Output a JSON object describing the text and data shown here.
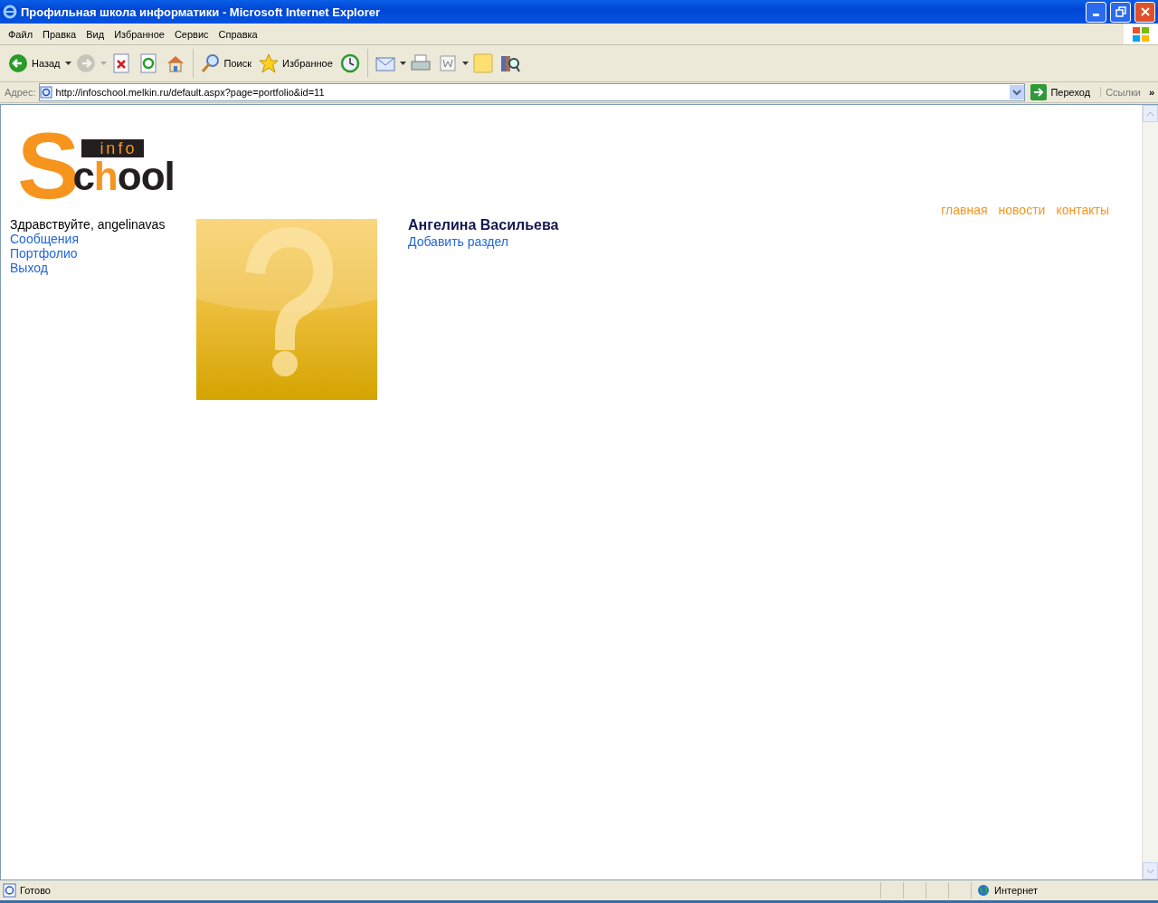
{
  "window": {
    "title": "Профильная школа информатики - Microsoft Internet Explorer"
  },
  "menu": [
    "Файл",
    "Правка",
    "Вид",
    "Избранное",
    "Сервис",
    "Справка"
  ],
  "toolbar": [
    {
      "kind": "back",
      "label": "Назад",
      "disabled": false,
      "has_menu": true
    },
    {
      "kind": "forward",
      "disabled": true,
      "has_menu": true
    },
    {
      "kind": "stop",
      "disabled": false,
      "has_menu": false
    },
    {
      "kind": "refresh",
      "disabled": false,
      "has_menu": false
    },
    {
      "kind": "home",
      "disabled": false,
      "has_menu": false
    },
    {
      "kind": "search",
      "label": "Поиск",
      "disabled": false,
      "has_menu": false
    },
    {
      "kind": "favorites",
      "label": "Избранное",
      "disabled": false,
      "has_menu": false
    },
    {
      "kind": "history",
      "disabled": false,
      "has_menu": false
    },
    {
      "kind": "mail",
      "disabled": false,
      "has_menu": true
    },
    {
      "kind": "print",
      "disabled": false,
      "has_menu": false
    },
    {
      "kind": "edit",
      "disabled": false,
      "has_menu": true
    },
    {
      "kind": "note",
      "disabled": false,
      "has_menu": false
    },
    {
      "kind": "research",
      "disabled": false,
      "has_menu": false
    }
  ],
  "address": {
    "label": "Адрес:",
    "value": "http://infoschool.melkin.ru/default.aspx?page=portfolio&id=11",
    "go": "Переход",
    "links": "Ссылки",
    "more": "»"
  },
  "page": {
    "logo": {
      "top": "info",
      "initial": "S",
      "rest": "chool"
    },
    "nav": [
      "главная",
      "новости",
      "контакты"
    ],
    "greeting": "Здравствуйте, angelinavas",
    "sidebar": [
      "Сообщения",
      "Портфолио",
      "Выход"
    ],
    "name": "Ангелина Васильева",
    "add_section": "Добавить раздел"
  },
  "status_bar": {
    "text": "Готово",
    "zone": "Интернет"
  }
}
